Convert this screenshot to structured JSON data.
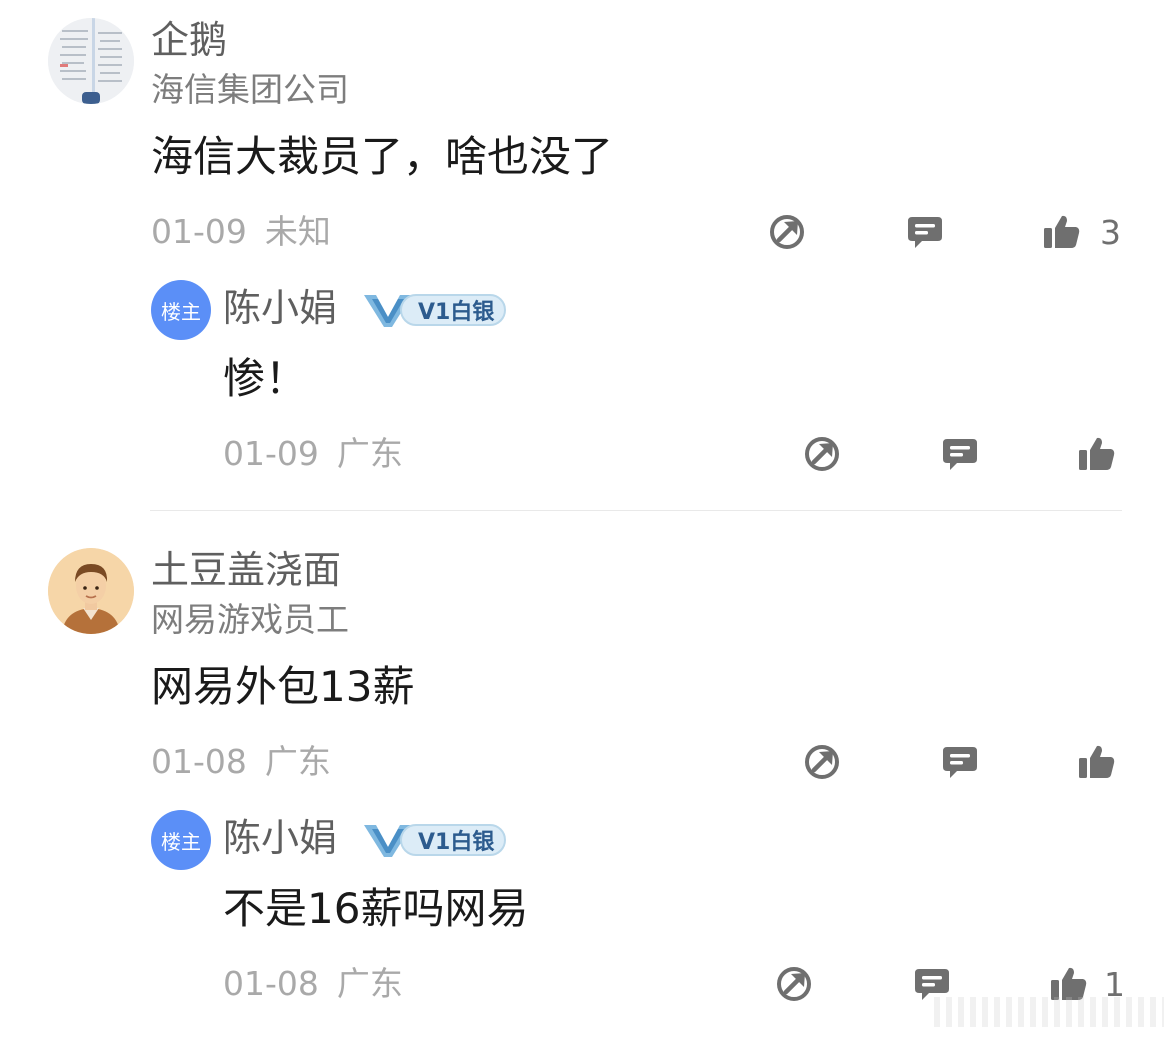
{
  "colors": {
    "host_badge": "#5b8ff7",
    "level_badge": "#2c5b8e",
    "meta_text": "#a9a9a9",
    "icon": "#6f6f6f"
  },
  "comments": [
    {
      "username": "企鹅",
      "company": "海信集团公司",
      "text": "海信大裁员了，啥也没了",
      "date": "01-09",
      "location": "未知",
      "like_count": "3",
      "icons": [
        "share-icon",
        "comment-icon",
        "thumb-up-icon"
      ],
      "reply": {
        "badge": "楼主",
        "username": "陈小娟",
        "level": "V1白银",
        "text": "惨！",
        "date": "01-09",
        "location": "广东",
        "like_count": ""
      }
    },
    {
      "username": "土豆盖浇面",
      "company": "网易游戏员工",
      "text": "网易外包13薪",
      "date": "01-08",
      "location": "广东",
      "like_count": "",
      "icons": [
        "share-icon",
        "comment-icon",
        "thumb-up-icon"
      ],
      "reply": {
        "badge": "楼主",
        "username": "陈小娟",
        "level": "V1白银",
        "text": "不是16薪吗网易",
        "date": "01-08",
        "location": "广东",
        "like_count": "1"
      }
    }
  ]
}
